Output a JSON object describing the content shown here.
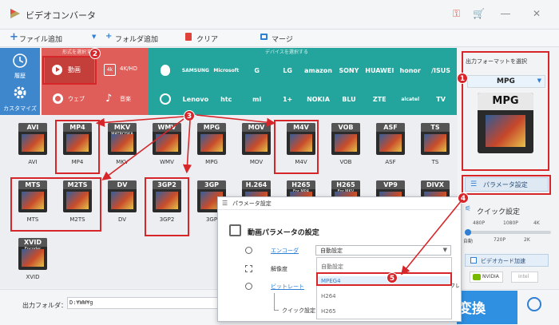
{
  "app": {
    "title": "ビデオコンバータ"
  },
  "toolbar": {
    "add_file": "ファイル追加",
    "add_folder": "フォルダ追加",
    "clear": "クリア",
    "merge": "マージ"
  },
  "category": {
    "history": "履歴",
    "custom": "カスタマイズ",
    "video_section": "形式を選択する",
    "device_section": "デバイスを選択する"
  },
  "tabs": {
    "video": "動画",
    "hd": "4K/HD",
    "web": "ウェブ",
    "music": "音楽"
  },
  "devices": {
    "row1": [
      "",
      "SAMSUNG",
      "Microsoft",
      "G",
      "LG",
      "amazon",
      "SONY",
      "HUAWEI",
      "honor",
      "/ISUS"
    ],
    "row2": [
      "",
      "Lenovo",
      "htc",
      "mi",
      "1+",
      "NOKIA",
      "BLU",
      "ZTE",
      "alcatel",
      "TV"
    ]
  },
  "formats": {
    "row1": [
      "AVI",
      "MP4",
      "MKV",
      "WMV",
      "MPG",
      "MOV",
      "M4V",
      "VOB",
      "ASF",
      "TS"
    ],
    "row2": [
      "MTS",
      "M2TS",
      "DV",
      "3GP2",
      "3GP"
    ],
    "row2_partial": [
      {
        "tag": "H.264",
        "sub": ""
      },
      {
        "tag": "H265",
        "sub": "For MP4"
      },
      {
        "tag": "H265",
        "sub": "For MKV"
      },
      {
        "tag": "VP9",
        "sub": ""
      },
      {
        "tag": "DIVX",
        "sub": ""
      }
    ],
    "row3": [
      "XVID"
    ],
    "xvid_sub": "Encoder",
    "mkv_sub": "MATROSKA"
  },
  "right": {
    "output_format_title": "出力フォーマットを選択",
    "selected_format": "MPG",
    "param_button": "パラメータ設定",
    "quick_settings": "クイック設定",
    "res_low": [
      "480P",
      "1080P",
      "4K"
    ],
    "res_high": [
      "自動",
      "720P",
      "2K"
    ],
    "gpu_label": "ビデオカード加速",
    "nvidia": "NVIDIA",
    "intel": "Intel"
  },
  "bottom": {
    "folder_label": "出力フォルダ：",
    "folder_value": "D:¥WW¥g",
    "convert": "変換"
  },
  "dialog": {
    "title": "パラメータ設定",
    "heading": "動画パラメータの設定",
    "encoder_label": "エンコーダ",
    "encoder_value": "自動設定",
    "resolution_label": "解像度",
    "bitrate_label": "ビットレート",
    "quick_label": "クイック設定",
    "fps_label": "フレ"
  },
  "dropdown": {
    "options": [
      "自動設定",
      "MPEG4",
      "H264",
      "H265"
    ]
  },
  "badges": [
    "1",
    "2",
    "3",
    "4",
    "5"
  ],
  "colors": {
    "accent_red": "#d6262a",
    "accent_blue": "#3f87cc",
    "device_teal": "#23a49c",
    "video_pink": "#e05e5a"
  }
}
